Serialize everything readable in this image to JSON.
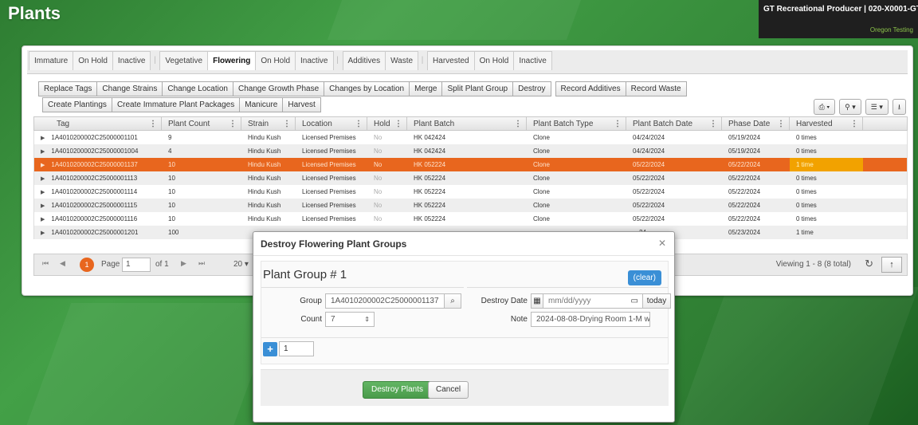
{
  "page": {
    "title": "Plants"
  },
  "facility": {
    "name": "GT Recreational Producer | 020-X0001-GT ▾",
    "sub": "Oregon Testing"
  },
  "tabs": {
    "group1": [
      "Immature",
      "On Hold",
      "Inactive"
    ],
    "group2": [
      "Vegetative",
      "Flowering",
      "On Hold",
      "Inactive"
    ],
    "group3": [
      "Additives",
      "Waste"
    ],
    "group4": [
      "Harvested",
      "On Hold",
      "Inactive"
    ],
    "active": "Flowering"
  },
  "toolbar": {
    "row1": [
      "Replace Tags",
      "Change Strains",
      "Change Location",
      "Change Growth Phase",
      "Changes by Location",
      "Merge",
      "Split Plant Group",
      "Destroy"
    ],
    "row1b": [
      "Record Additives",
      "Record Waste"
    ],
    "row2": [
      "Create Plantings",
      "Create Immature Plant Packages",
      "Manicure",
      "Harvest"
    ]
  },
  "right_tools": [
    "⎙ ▾",
    "⚲ ▾",
    "☰ ▾",
    "⭳"
  ],
  "grid": {
    "columns": [
      "Tag",
      "Plant Count",
      "Strain",
      "Location",
      "Hold",
      "Plant Batch",
      "Plant Batch Type",
      "Plant Batch Date",
      "Phase Date",
      "Harvested"
    ],
    "rows": [
      [
        "1A4010200002C25000001101",
        "9",
        "Hindu Kush",
        "Licensed Premises",
        "No",
        "HK 042424",
        "Clone",
        "04/24/2024",
        "05/19/2024",
        "0 times"
      ],
      [
        "1A4010200002C25000001004",
        "4",
        "Hindu Kush",
        "Licensed Premises",
        "No",
        "HK 042424",
        "Clone",
        "04/24/2024",
        "05/19/2024",
        "0 times"
      ],
      [
        "1A4010200002C25000001137",
        "10",
        "Hindu Kush",
        "Licensed Premises",
        "No",
        "HK 052224",
        "Clone",
        "05/22/2024",
        "05/22/2024",
        "1 time"
      ],
      [
        "1A4010200002C25000001113",
        "10",
        "Hindu Kush",
        "Licensed Premises",
        "No",
        "HK 052224",
        "Clone",
        "05/22/2024",
        "05/22/2024",
        "0 times"
      ],
      [
        "1A4010200002C25000001114",
        "10",
        "Hindu Kush",
        "Licensed Premises",
        "No",
        "HK 052224",
        "Clone",
        "05/22/2024",
        "05/22/2024",
        "0 times"
      ],
      [
        "1A4010200002C25000001115",
        "10",
        "Hindu Kush",
        "Licensed Premises",
        "No",
        "HK 052224",
        "Clone",
        "05/22/2024",
        "05/22/2024",
        "0 times"
      ],
      [
        "1A4010200002C25000001116",
        "10",
        "Hindu Kush",
        "Licensed Premises",
        "No",
        "HK 052224",
        "Clone",
        "05/22/2024",
        "05/22/2024",
        "0 times"
      ],
      [
        "1A4010200002C25000001201",
        "100",
        "",
        "",
        "",
        "",
        "",
        "…24",
        "05/23/2024",
        "1 time"
      ]
    ],
    "selected_row": 2
  },
  "pager": {
    "current_badge": "1",
    "page_label": "Page",
    "page_value": "1",
    "of_label": "of 1",
    "per_page": "20 ▾",
    "viewing": "Viewing 1 - 8 (8 total)"
  },
  "modal": {
    "title": "Destroy Flowering Plant Groups",
    "group_title": "Plant Group # 1",
    "clear_label": "(clear)",
    "group_label": "Group",
    "group_value": "1A4010200002C25000001137",
    "count_label": "Count",
    "count_value": "7",
    "destroy_date_label": "Destroy Date",
    "destroy_date_placeholder": "mm/dd/yyyy",
    "today_label": "today",
    "note_label": "Note",
    "note_value": "2024-08-08-Drying Room 1-M wa",
    "add_count": "1",
    "destroy_button": "Destroy Plants",
    "cancel_button": "Cancel"
  }
}
